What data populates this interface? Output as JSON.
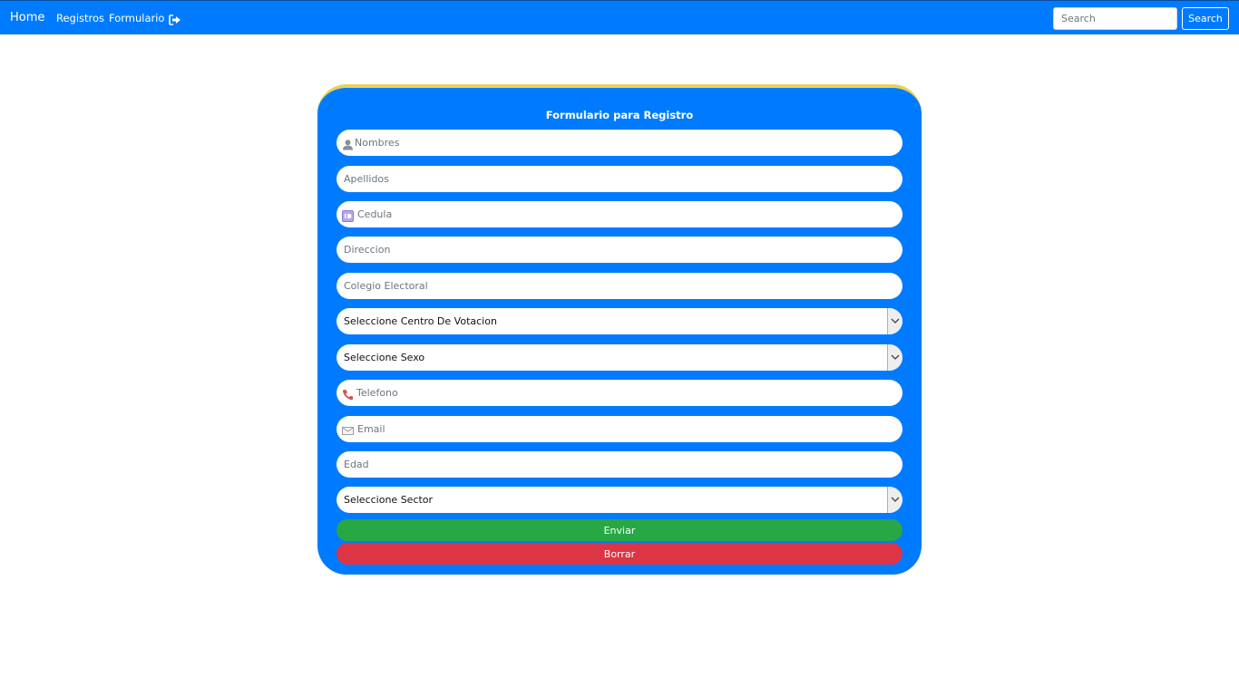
{
  "navbar": {
    "brand": "Home",
    "links": [
      "Registros",
      "Formulario"
    ],
    "logout_icon": "sign-out-icon",
    "search_placeholder": "Search",
    "search_button": "Search"
  },
  "form": {
    "title": "Formulario para Registro",
    "fields": {
      "nombres": {
        "placeholder": "Nombres",
        "icon": "user-icon",
        "value": ""
      },
      "apellidos": {
        "placeholder": "Apellidos",
        "value": ""
      },
      "cedula": {
        "placeholder": "Cedula",
        "icon": "id-card-icon",
        "value": ""
      },
      "direccion": {
        "placeholder": "Direccion",
        "value": ""
      },
      "colegio": {
        "placeholder": "Colegio Electoral",
        "value": ""
      },
      "centro": {
        "selected": "Seleccione Centro De Votacion"
      },
      "sexo": {
        "selected": "Seleccione Sexo"
      },
      "telefono": {
        "placeholder": "Telefono",
        "icon": "phone-icon",
        "value": ""
      },
      "email": {
        "placeholder": "Email",
        "icon": "envelope-icon",
        "value": ""
      },
      "edad": {
        "placeholder": "Edad",
        "value": ""
      },
      "sector": {
        "selected": "Seleccione Sector"
      }
    },
    "submit_label": "Enviar",
    "reset_label": "Borrar"
  },
  "colors": {
    "primary": "#007bff",
    "card_top_border": "#e4d35a",
    "success": "#28a745",
    "danger": "#dc3545"
  }
}
